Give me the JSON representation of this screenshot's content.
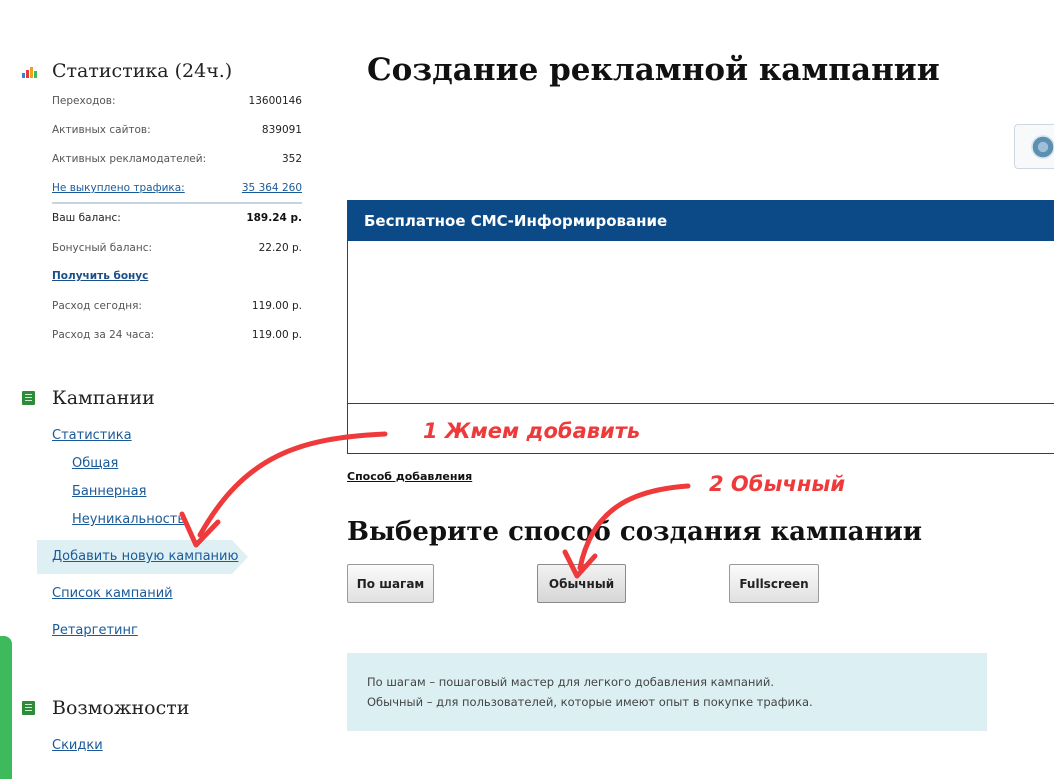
{
  "sidebar": {
    "stats_title": "Статистика (24ч.)",
    "stats": [
      {
        "label": "Переходов:",
        "value": "13600146"
      },
      {
        "label": "Активных сайтов:",
        "value": "839091"
      },
      {
        "label": "Активных рекламодателей:",
        "value": "352"
      },
      {
        "label": "Не выкуплено трафика:",
        "value": "35 364 260"
      },
      {
        "label": "Ваш баланс:",
        "value": "189.24 р."
      },
      {
        "label": "Бонусный баланс:",
        "value": "22.20 р."
      },
      {
        "label": "Расход сегодня:",
        "value": "119.00 р."
      },
      {
        "label": "Расход за 24 часа:",
        "value": "119.00 р."
      }
    ],
    "bonus_link": "Получить бонус",
    "campaigns_title": "Кампании",
    "campaigns_nav": {
      "statistics": "Статистика",
      "general": "Общая",
      "banner": "Баннерная",
      "uniqueness": "Неуникальность",
      "add_new": "Добавить новую кампанию",
      "list": "Список кампаний",
      "retargeting": "Ретаргетинг"
    },
    "features_title": "Возможности",
    "features_nav": {
      "discounts": "Скидки"
    }
  },
  "main": {
    "page_title": "Создание рекламной кампании",
    "sms_panel_title": "Бесплатное СМС-Информирование",
    "method_link": "Способ добавления",
    "choose_title": "Выберите способ создания кампании",
    "buttons": {
      "step_by_step": "По шагам",
      "normal": "Обычный",
      "fullscreen": "Fullscreen"
    },
    "info_lines": [
      "По шагам – пошаговый мастер для легкого добавления кампаний.",
      "Обычный – для пользователей, которые имеют опыт в покупке трафика."
    ]
  },
  "annotations": {
    "step1": "1 Жмем добавить",
    "step2": "2 Обычный"
  },
  "colors": {
    "panel_header": "#0c4a87",
    "link": "#1a5a99",
    "annotation": "#ee3a3a",
    "info_bg": "#dcf0f3",
    "active_nav_bg": "#dff0f4"
  },
  "icons": {
    "stats": "bar-chart-icon",
    "campaigns": "document-icon",
    "features": "document-icon",
    "logo": "brand-logo-icon"
  }
}
